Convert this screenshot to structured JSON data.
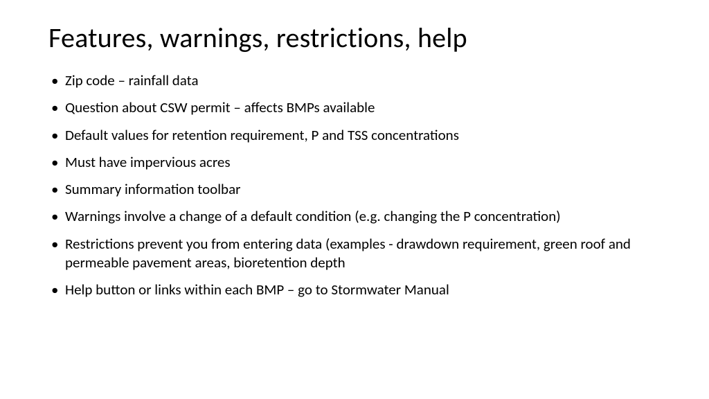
{
  "slide": {
    "title": "Features, warnings, restrictions, help",
    "bullets": [
      "Zip code – rainfall data",
      "Question about CSW permit – affects BMPs available",
      "Default values for retention requirement, P and TSS concentrations",
      "Must have impervious acres",
      "Summary information toolbar",
      "Warnings involve a change of a default condition (e.g. changing the P concentration)",
      "Restrictions prevent you from entering data (examples - drawdown requirement, green roof and permeable pavement areas, bioretention depth",
      "Help button or links within each BMP – go to Stormwater Manual"
    ]
  }
}
